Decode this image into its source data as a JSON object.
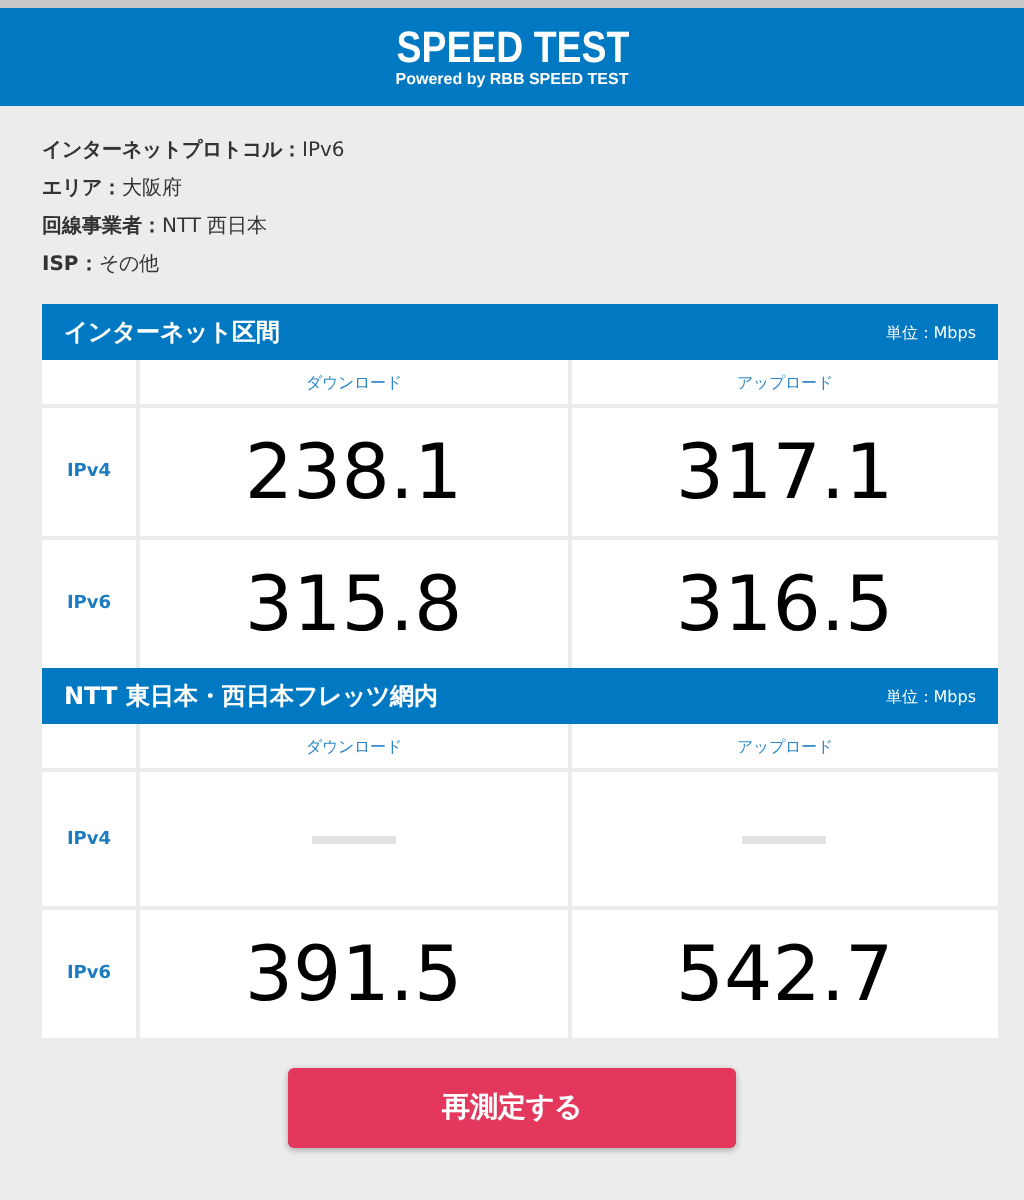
{
  "header": {
    "title": "SPEED TEST",
    "subtitle": "Powered by RBB SPEED TEST"
  },
  "info": [
    {
      "label": "インターネットプロトコル：",
      "value": "IPv6"
    },
    {
      "label": "エリア：",
      "value": "大阪府"
    },
    {
      "label": "回線事業者：",
      "value": "NTT 西日本"
    },
    {
      "label": "ISP：",
      "value": "その他"
    }
  ],
  "sections": [
    {
      "title": "インターネット区間",
      "unit": "単位：Mbps",
      "columns": [
        "ダウンロード",
        "アップロード"
      ],
      "rows": [
        {
          "label": "IPv4",
          "cells": [
            {
              "kind": "value",
              "text": "238.1"
            },
            {
              "kind": "value",
              "text": "317.1"
            }
          ]
        },
        {
          "label": "IPv6",
          "cells": [
            {
              "kind": "value",
              "text": "315.8"
            },
            {
              "kind": "value",
              "text": "316.5"
            }
          ]
        }
      ]
    },
    {
      "title": "NTT 東日本・西日本フレッツ網内",
      "unit": "単位：Mbps",
      "columns": [
        "ダウンロード",
        "アップロード"
      ],
      "rows": [
        {
          "label": "IPv4",
          "cells": [
            {
              "kind": "empty"
            },
            {
              "kind": "empty"
            }
          ]
        },
        {
          "label": "IPv6",
          "cells": [
            {
              "kind": "value",
              "text": "391.5"
            },
            {
              "kind": "value",
              "text": "542.7"
            }
          ]
        }
      ]
    }
  ],
  "button": "再測定する"
}
